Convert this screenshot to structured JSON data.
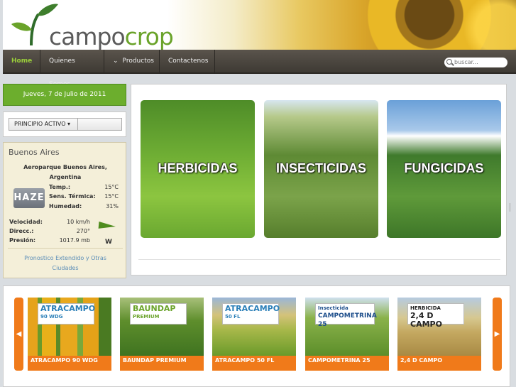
{
  "brand": {
    "name_part1": "campo",
    "name_part2": "crop"
  },
  "nav": {
    "items": [
      {
        "label": "Home",
        "active": true
      },
      {
        "label": "Quienes Somos",
        "active": false
      },
      {
        "label": "Productos",
        "active": false
      },
      {
        "label": "Contactenos",
        "active": false
      }
    ],
    "search_placeholder": "buscar..."
  },
  "date": "Jueves, 7 de Julio de 2011",
  "active_principle": {
    "label": "PRINCIPIO ACTIVO"
  },
  "weather": {
    "city": "Buenos Aires",
    "station": "Aeroparque Buenos Aires, Argentina",
    "condition_icon_text": "HAZE",
    "temp_label": "Temp.:",
    "temp": "15°C",
    "feels_label": "Sens. Térmica:",
    "feels": "15°C",
    "humidity_label": "Humedad:",
    "humidity": "31%",
    "wind_label": "Velocidad:",
    "wind": "10 km/h",
    "dir_label": "Direcc.:",
    "dir": "270°",
    "pressure_label": "Presión:",
    "pressure": "1017.9 mb",
    "wind_dir_letter": "W",
    "extended_link": "Pronostico Extendido y Otras Ciudades"
  },
  "categories": [
    {
      "label": "HERBICIDAS"
    },
    {
      "label": "INSECTICIDAS"
    },
    {
      "label": "FUNGICIDAS"
    }
  ],
  "carousel": {
    "prev": "◀",
    "next": "▶",
    "products": [
      {
        "label": "ATRACAMPO 90 WDG",
        "pack_line1": "ATRACAMPO",
        "pack_line2": "90 WDG"
      },
      {
        "label": "BAUNDAP PREMIUM",
        "pack_line1": "BAUNDAP",
        "pack_line2": "PREMIUM"
      },
      {
        "label": "ATRACAMPO 50 FL",
        "pack_line1": "ATRACAMPO",
        "pack_line2": "50 FL"
      },
      {
        "label": "CAMPOMETRINA 25",
        "pack_line1": "Insecticida",
        "pack_line2": "CAMPOMETRINA 25"
      },
      {
        "label": "2,4 D CAMPO",
        "pack_line1": "HERBICIDA",
        "pack_line2": "2,4 D CAMPO"
      }
    ]
  }
}
